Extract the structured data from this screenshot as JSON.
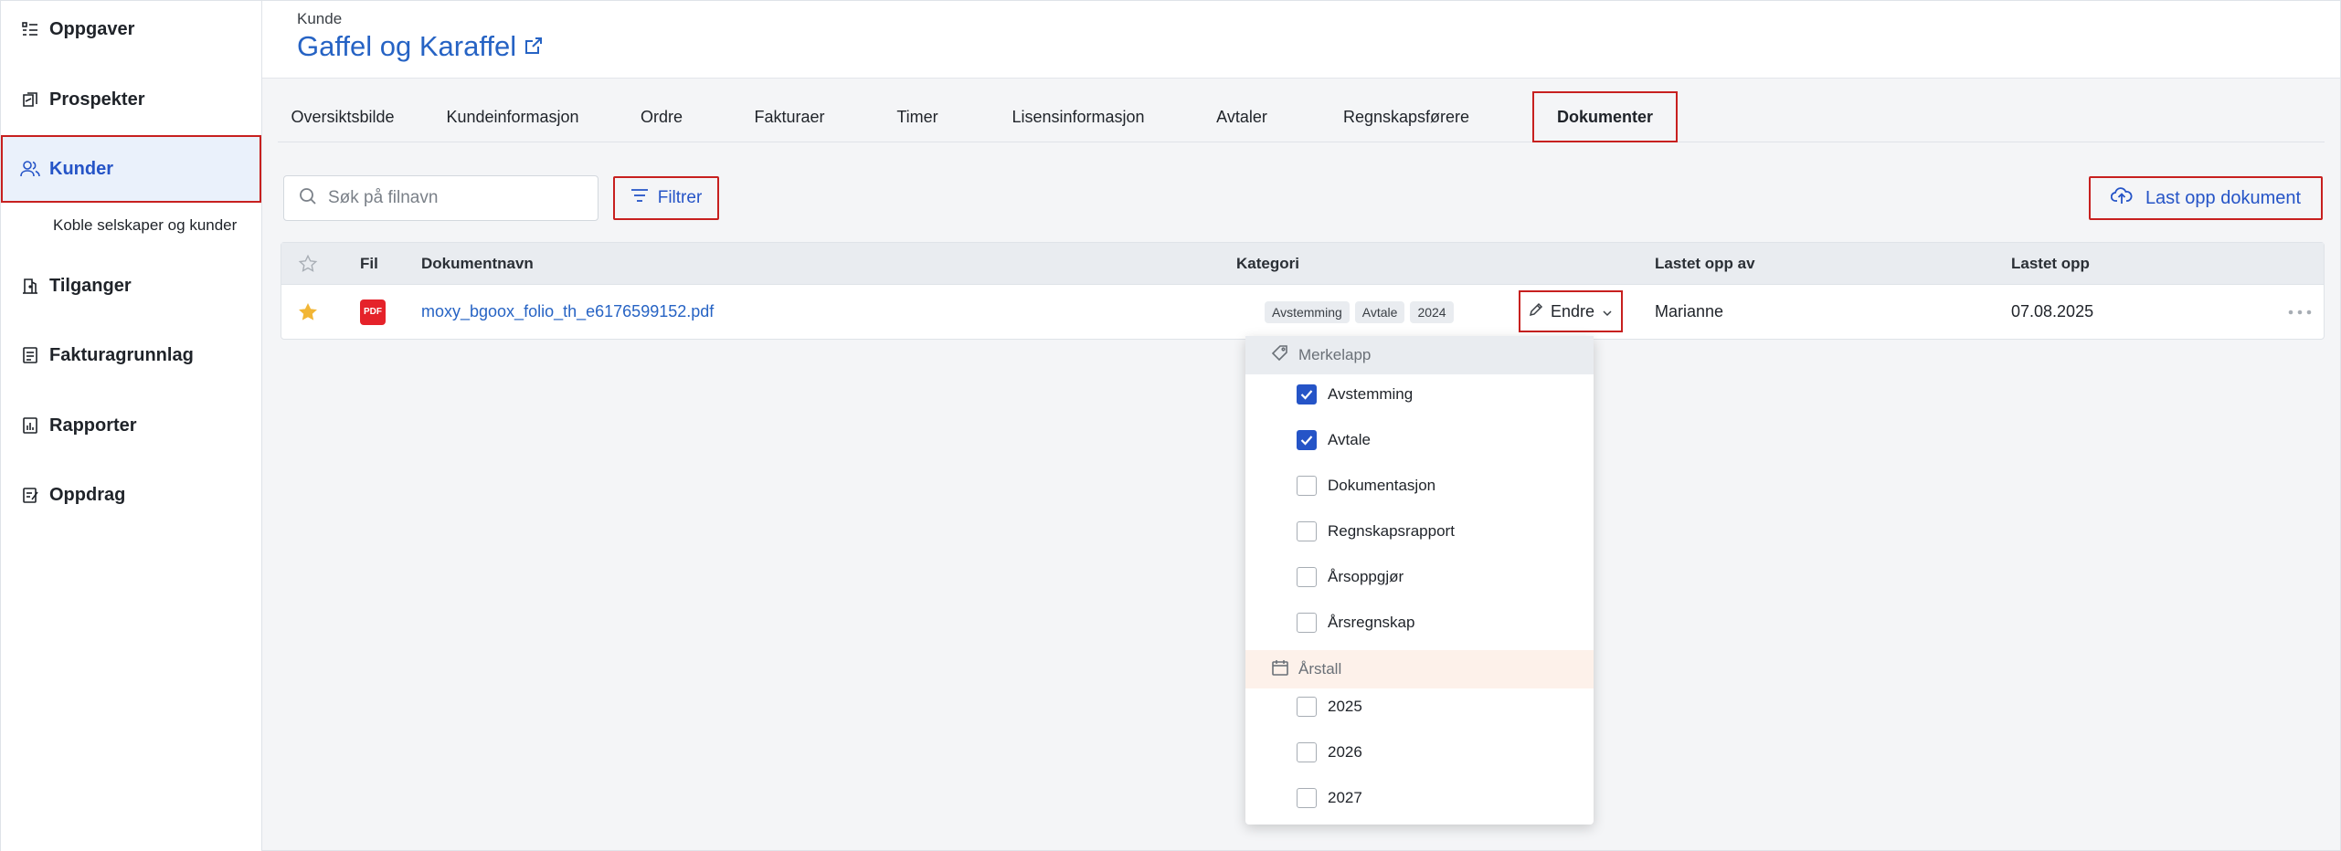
{
  "sidebar": {
    "items": [
      {
        "label": "Oppgaver",
        "icon": "task-list-icon"
      },
      {
        "label": "Prospekter",
        "icon": "prospect-icon"
      },
      {
        "label": "Kunder",
        "icon": "users-icon"
      },
      {
        "label": "Tilganger",
        "icon": "access-icon"
      },
      {
        "label": "Fakturagrunnlag",
        "icon": "document-icon"
      },
      {
        "label": "Rapporter",
        "icon": "report-icon"
      },
      {
        "label": "Oppdrag",
        "icon": "assignment-icon"
      }
    ],
    "sub_item": "Koble selskaper og kunder",
    "active": "Kunder"
  },
  "header": {
    "breadcrumb": "Kunde",
    "title": "Gaffel og Karaffel"
  },
  "tabs": [
    {
      "label": "Oversiktsbilde"
    },
    {
      "label": "Kundeinformasjon"
    },
    {
      "label": "Ordre"
    },
    {
      "label": "Fakturaer"
    },
    {
      "label": "Timer"
    },
    {
      "label": "Lisensinformasjon"
    },
    {
      "label": "Avtaler"
    },
    {
      "label": "Regnskapsførere"
    },
    {
      "label": "Dokumenter"
    }
  ],
  "active_tab": "Dokumenter",
  "toolbar": {
    "search_placeholder": "Søk på filnavn",
    "filter_label": "Filtrer",
    "upload_label": "Last opp dokument"
  },
  "table": {
    "headers": {
      "file": "Fil",
      "name": "Dokumentnavn",
      "category": "Kategori",
      "uploaded_by": "Lastet opp av",
      "uploaded": "Lastet opp"
    },
    "rows": [
      {
        "starred": true,
        "file_type": "PDF",
        "name": "moxy_bgoox_folio_th_e6176599152.pdf",
        "tags": [
          "Avstemming",
          "Avtale",
          "2024"
        ],
        "edit_label": "Endre",
        "uploaded_by": "Marianne",
        "uploaded": "07.08.2025"
      }
    ]
  },
  "dropdown": {
    "tag_group_label": "Merkelapp",
    "tag_options": [
      {
        "label": "Avstemming",
        "checked": true
      },
      {
        "label": "Avtale",
        "checked": true
      },
      {
        "label": "Dokumentasjon",
        "checked": false
      },
      {
        "label": "Regnskapsrapport",
        "checked": false
      },
      {
        "label": "Årsoppgjør",
        "checked": false
      },
      {
        "label": "Årsregnskap",
        "checked": false
      }
    ],
    "year_group_label": "Årstall",
    "year_options": [
      {
        "label": "2025",
        "checked": false
      },
      {
        "label": "2026",
        "checked": false
      },
      {
        "label": "2027",
        "checked": false
      }
    ]
  },
  "colors": {
    "accent": "#2554c7",
    "link": "#2663c4",
    "highlight_border": "#c7201f",
    "star": "#f2b636",
    "pdf": "#e5222a"
  }
}
